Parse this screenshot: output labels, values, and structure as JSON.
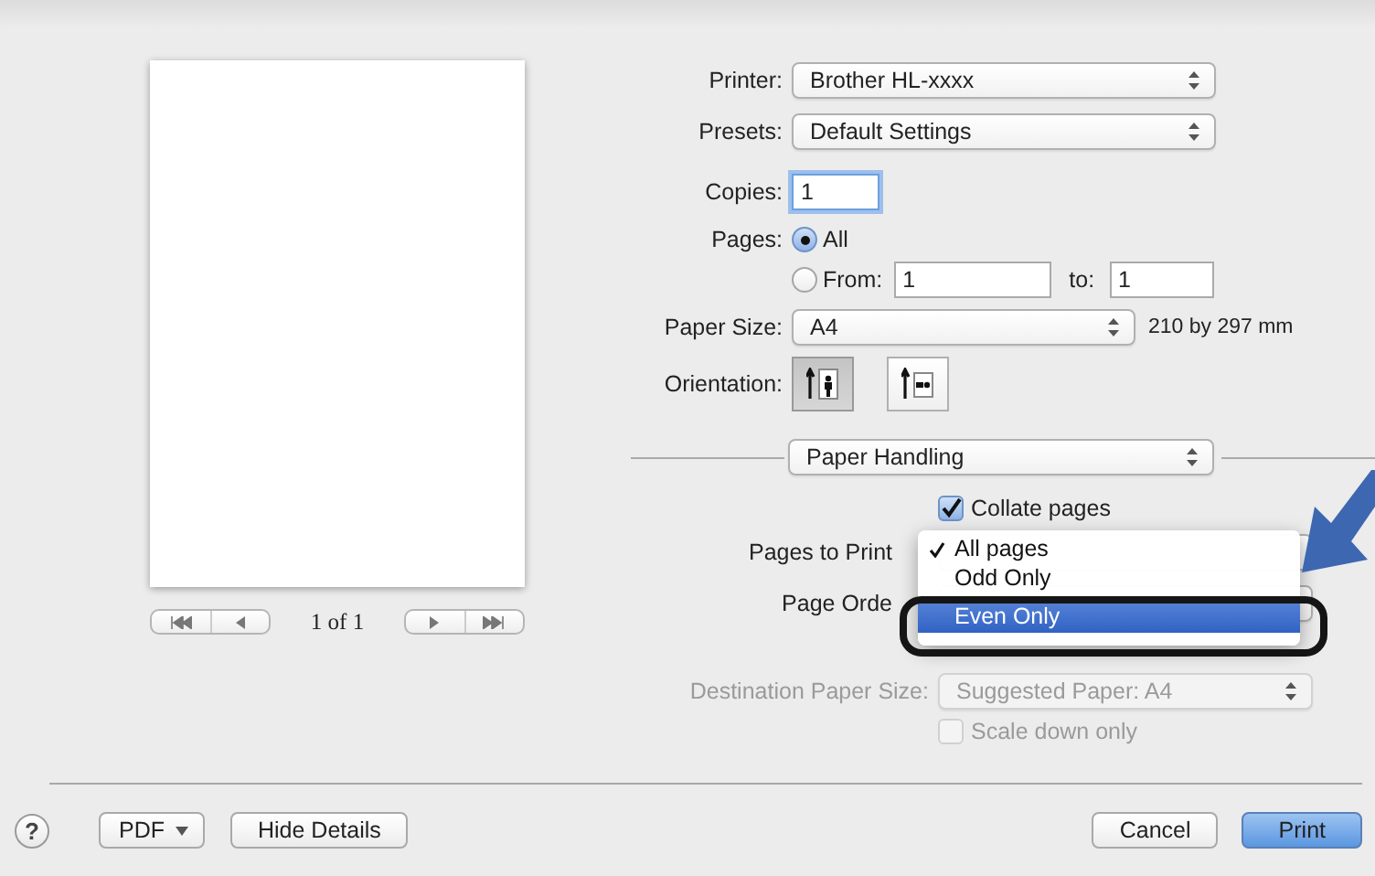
{
  "preview": {
    "page_count": "1 of 1"
  },
  "printer": {
    "label": "Printer:",
    "value": "Brother HL-xxxx"
  },
  "presets": {
    "label": "Presets:",
    "value": "Default Settings"
  },
  "copies": {
    "label": "Copies:",
    "value": "1"
  },
  "pages": {
    "label": "Pages:",
    "options": [
      {
        "label": "All",
        "selected": true
      },
      {
        "label": "From:",
        "selected": false
      }
    ],
    "from": "1",
    "to_label": "to:",
    "to": "1"
  },
  "paper_size": {
    "label": "Paper Size:",
    "value": "A4",
    "dimensions": "210 by 297 mm"
  },
  "orientation": {
    "label": "Orientation:",
    "options": [
      {
        "kind": "portrait",
        "selected": true
      },
      {
        "kind": "landscape",
        "selected": false
      }
    ]
  },
  "section": {
    "value": "Paper Handling"
  },
  "collate": {
    "label": "Collate pages",
    "checked": true
  },
  "pages_to_print": {
    "label": "Pages to Print",
    "menu": {
      "items": [
        {
          "label": "All pages",
          "checked": true,
          "selected": false
        },
        {
          "label": "Odd Only",
          "checked": false,
          "selected": false
        },
        {
          "label": "Even Only",
          "checked": false,
          "selected": true
        }
      ]
    }
  },
  "page_order": {
    "label": "Page Orde"
  },
  "destination_paper_size": {
    "label": "Destination Paper Size:",
    "value": "Suggested Paper: A4",
    "disabled": true
  },
  "scale_down": {
    "label": "Scale down only",
    "checked": false,
    "disabled": true
  },
  "footer": {
    "help": "?",
    "pdf": "PDF",
    "hide_details": "Hide Details",
    "cancel": "Cancel",
    "print": "Print"
  }
}
